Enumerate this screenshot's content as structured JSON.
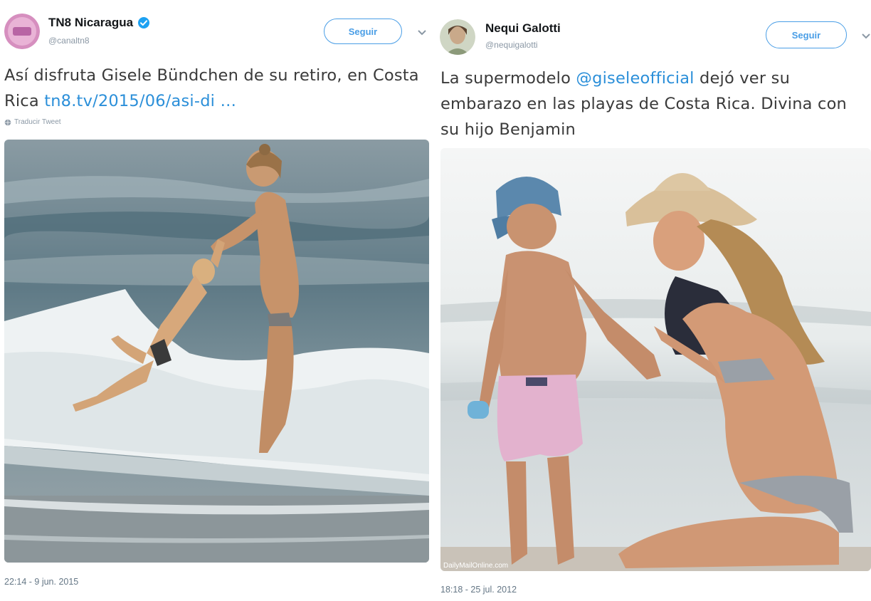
{
  "tweets": [
    {
      "display_name": "TN8 Nicaragua",
      "handle": "@canaltn8",
      "verified": true,
      "follow_label": "Seguir",
      "text_prefix": "Así disfruta Gisele Bündchen de su retiro, en Costa Rica ",
      "link_text": "tn8.tv/2015/06/asi-di",
      "link_suffix": " …",
      "translate_label": "Traducir Tweet",
      "timestamp": "22:14 - 9 jun. 2015"
    },
    {
      "display_name": "Nequi Galotti",
      "handle": "@nequigalotti",
      "verified": false,
      "follow_label": "Seguir",
      "text_prefix": "La supermodelo ",
      "mention": "@giseleofficial",
      "text_suffix": " dejó ver su embarazo en las playas de Costa Rica. Divina con su hijo Benjamin",
      "photo_credit": "DailyMailOnline.com",
      "timestamp": "18:18 - 25 jul. 2012"
    }
  ],
  "icons": {
    "verified": "verified-badge-icon",
    "chevron": "chevron-down-icon",
    "globe": "globe-icon"
  },
  "colors": {
    "link": "#2b8fd9",
    "follow": "#4a9ee6",
    "verified": "#1da1f2"
  }
}
